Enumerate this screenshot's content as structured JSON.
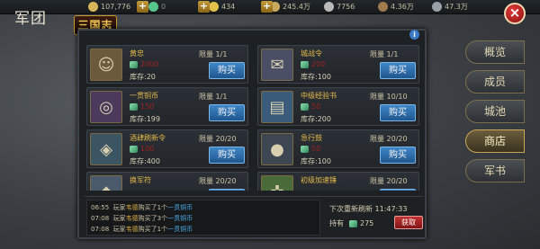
{
  "window": {
    "title": "军团",
    "close_label": "×"
  },
  "logo": {
    "text": "三国志"
  },
  "resources": [
    {
      "icon": "copper-coin-icon",
      "value": "107,776",
      "color": "#d6b45a"
    },
    {
      "icon": "jade-gem-icon",
      "value": "0",
      "color": "#58c68a"
    },
    {
      "icon": "gold-ingot-icon",
      "value": "434",
      "color": "#e2c04a"
    },
    {
      "icon": "food-icon",
      "value": "245.4万",
      "color": "#c7a85c"
    },
    {
      "icon": "troops-icon",
      "value": "7756",
      "color": "#b9b9b9"
    },
    {
      "icon": "wood-icon",
      "value": "4.36万",
      "color": "#a07a4e"
    },
    {
      "icon": "iron-icon",
      "value": "47.3万",
      "color": "#9aa0a8"
    }
  ],
  "info_label": "i",
  "shop": {
    "items": [
      {
        "name": "黄忠",
        "limit": "限量 1/1",
        "price": "2000",
        "stock": "库存:20",
        "buy_label": "购买",
        "icon": "general-portrait-icon",
        "thumb_color": "#6b5a3b",
        "glyph": "☺"
      },
      {
        "name": "城战令",
        "limit": "限量 1/1",
        "price": "200",
        "stock": "库存:100",
        "buy_label": "购买",
        "icon": "siege-token-icon",
        "thumb_color": "#4a4f66",
        "glyph": "✉"
      },
      {
        "name": "一贯铜币",
        "limit": "限量 1/1",
        "price": "150",
        "stock": "库存:199",
        "buy_label": "购买",
        "icon": "copper-coins-icon",
        "thumb_color": "#4c3a5c",
        "glyph": "◎"
      },
      {
        "name": "中级经验书",
        "limit": "限量 10/10",
        "price": "50",
        "stock": "库存:200",
        "buy_label": "购买",
        "icon": "exp-book-icon",
        "thumb_color": "#3a5c7a",
        "glyph": "▤"
      },
      {
        "name": "酒肆刷新令",
        "limit": "限量 20/20",
        "price": "100",
        "stock": "库存:400",
        "buy_label": "购买",
        "icon": "tavern-refresh-token-icon",
        "thumb_color": "#3c5563",
        "glyph": "◈"
      },
      {
        "name": "急行鼓",
        "limit": "限量 20/20",
        "price": "50",
        "stock": "库存:100",
        "buy_label": "购买",
        "icon": "march-drum-icon",
        "thumb_color": "#3e4652",
        "glyph": "●"
      },
      {
        "name": "换军符",
        "limit": "限量 20/20",
        "price": "",
        "stock": "",
        "buy_label": "购买",
        "icon": "army-tally-icon",
        "thumb_color": "#4a5a6a",
        "glyph": "◆"
      },
      {
        "name": "初级加速锤",
        "limit": "限量 20/20",
        "price": "",
        "stock": "",
        "buy_label": "购买",
        "icon": "speedup-hammer-icon",
        "thumb_color": "#4a6a3a",
        "glyph": "✜"
      }
    ]
  },
  "log": [
    {
      "time": "06:55",
      "text_a": "玩家",
      "player": "韦德",
      "text_b": "购买了1个",
      "item": "一贯铜币"
    },
    {
      "time": "07:08",
      "text_a": "玩家",
      "player": "韦德",
      "text_b": "购买了3个",
      "item": "一贯铜币"
    },
    {
      "time": "07:08",
      "text_a": "玩家",
      "player": "韦德",
      "text_b": "购买了1个",
      "item": "一贯铜币"
    }
  ],
  "footer": {
    "refresh_label": "下次重新刷新",
    "refresh_time": "11:47:33",
    "currency_label": "持有",
    "currency_value": "275",
    "get_label": "获取"
  },
  "tabs": [
    {
      "label": "概览",
      "active": false
    },
    {
      "label": "成员",
      "active": false
    },
    {
      "label": "城池",
      "active": false
    },
    {
      "label": "商店",
      "active": true
    },
    {
      "label": "军书",
      "active": false
    }
  ]
}
